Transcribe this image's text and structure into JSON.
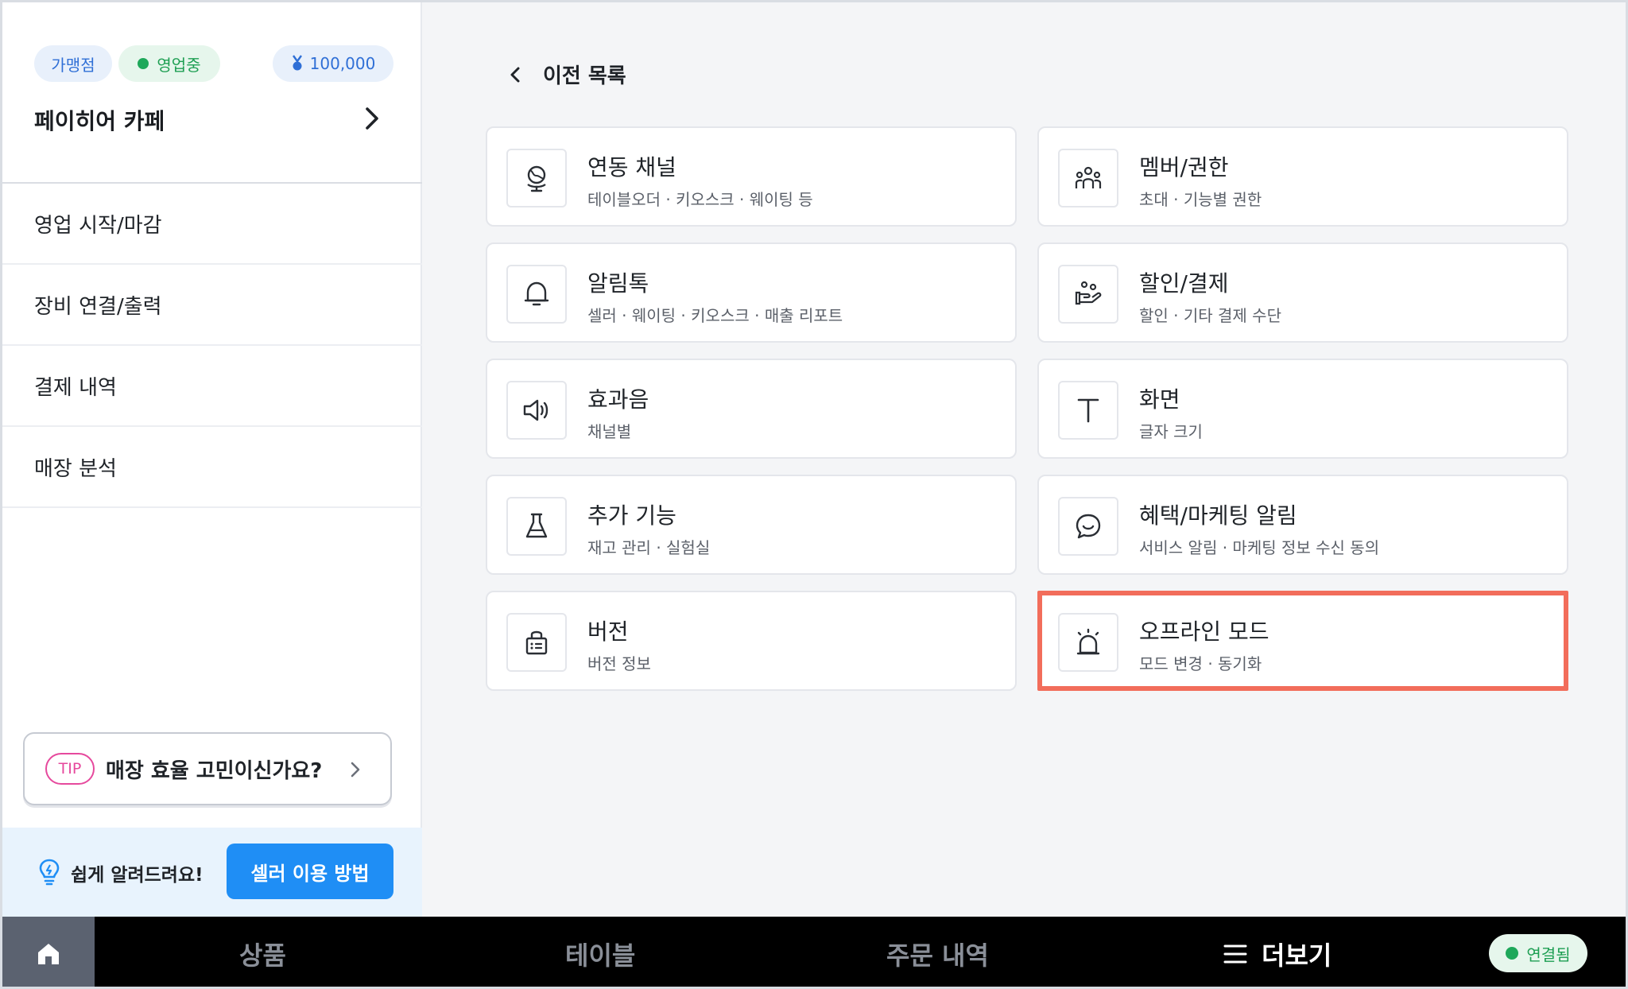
{
  "sidebar": {
    "badges": {
      "franchise": "가맹점",
      "status": "영업중",
      "points": "100,000"
    },
    "store_name": "페이히어 카페",
    "menu": [
      {
        "label": "영업 시작/마감"
      },
      {
        "label": "장비 연결/출력"
      },
      {
        "label": "결제 내역"
      },
      {
        "label": "매장 분석"
      }
    ],
    "tip": {
      "badge": "TIP",
      "text": "매장 효율 고민이신가요?"
    },
    "help": {
      "text": "쉽게 알려드려요!",
      "button": "셀러 이용 방법"
    }
  },
  "main": {
    "back_label": "이전 목록",
    "cards": [
      {
        "icon": "globe-icon",
        "title": "연동 채널",
        "sub": "테이블오더 · 키오스크 · 웨이팅 등"
      },
      {
        "icon": "members-icon",
        "title": "멤버/권한",
        "sub": "초대 · 기능별 권한"
      },
      {
        "icon": "bell-icon",
        "title": "알림톡",
        "sub": "셀러 · 웨이팅 · 키오스크 · 매출 리포트"
      },
      {
        "icon": "hand-coins-icon",
        "title": "할인/결제",
        "sub": "할인 · 기타 결제 수단"
      },
      {
        "icon": "speaker-icon",
        "title": "효과음",
        "sub": "채널별"
      },
      {
        "icon": "text-icon",
        "title": "화면",
        "sub": "글자 크기"
      },
      {
        "icon": "flask-icon",
        "title": "추가 기능",
        "sub": "재고 관리 · 실험실"
      },
      {
        "icon": "chat-smile-icon",
        "title": "혜택/마케팅 알림",
        "sub": "서비스 알림 · 마케팅 정보 수신 동의"
      },
      {
        "icon": "bag-icon",
        "title": "버전",
        "sub": "버전 정보"
      },
      {
        "icon": "siren-icon",
        "title": "오프라인 모드",
        "sub": "모드 변경 · 동기화"
      }
    ]
  },
  "bottom_nav": {
    "home_icon": "home-icon",
    "items": [
      {
        "label": "상품"
      },
      {
        "label": "테이블"
      },
      {
        "label": "주문 내역"
      },
      {
        "label": "더보기"
      }
    ],
    "connection": "연결됨"
  },
  "colors": {
    "accent_blue": "#1f8ef5",
    "highlight": "#f26d5b",
    "status_green": "#1ea85a"
  }
}
